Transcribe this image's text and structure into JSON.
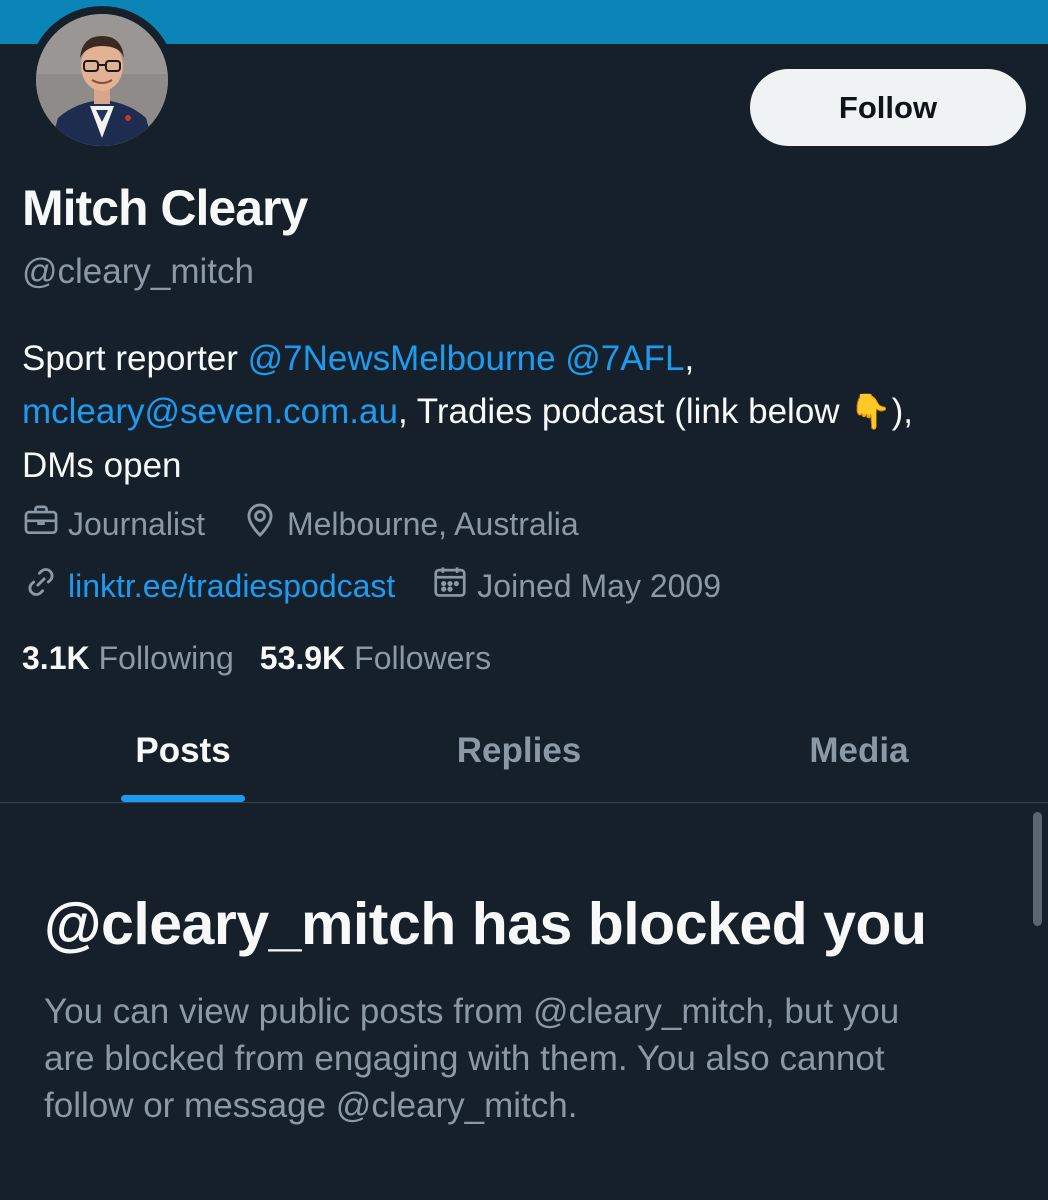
{
  "profile": {
    "display_name": "Mitch Cleary",
    "handle": "@cleary_mitch",
    "follow_label": "Follow",
    "bio": {
      "line1_text": "Sport reporter ",
      "mention1": "@7NewsMelbourne",
      "mention2": "@7AFL",
      "line1_end": ",",
      "email": "mcleary@seven.com.au",
      "line2_text": ", Tradies podcast (link below ",
      "emoji": "👇",
      "line2_end": "),",
      "line3_text": "DMs open"
    },
    "category": "Journalist",
    "location": "Melbourne, Australia",
    "website": "linktr.ee/tradiespodcast",
    "joined": "Joined May 2009",
    "following_count": "3.1K",
    "following_label": "Following",
    "followers_count": "53.9K",
    "followers_label": "Followers"
  },
  "tabs": [
    {
      "label": "Posts",
      "active": true
    },
    {
      "label": "Replies",
      "active": false
    },
    {
      "label": "Media",
      "active": false
    }
  ],
  "blocked": {
    "title": "@cleary_mitch has blocked you",
    "line1": "You can view public posts from @cleary_mitch, but you",
    "line2": "are blocked from engaging with them. You also cannot",
    "line3": "follow or message @cleary_mitch."
  },
  "colors": {
    "background": "#15202b",
    "banner": "#0b84b8",
    "accent": "#1d9bf0",
    "secondary_text": "#8b98a5"
  },
  "icons": [
    "briefcase-icon",
    "location-pin-icon",
    "link-icon",
    "calendar-icon"
  ]
}
